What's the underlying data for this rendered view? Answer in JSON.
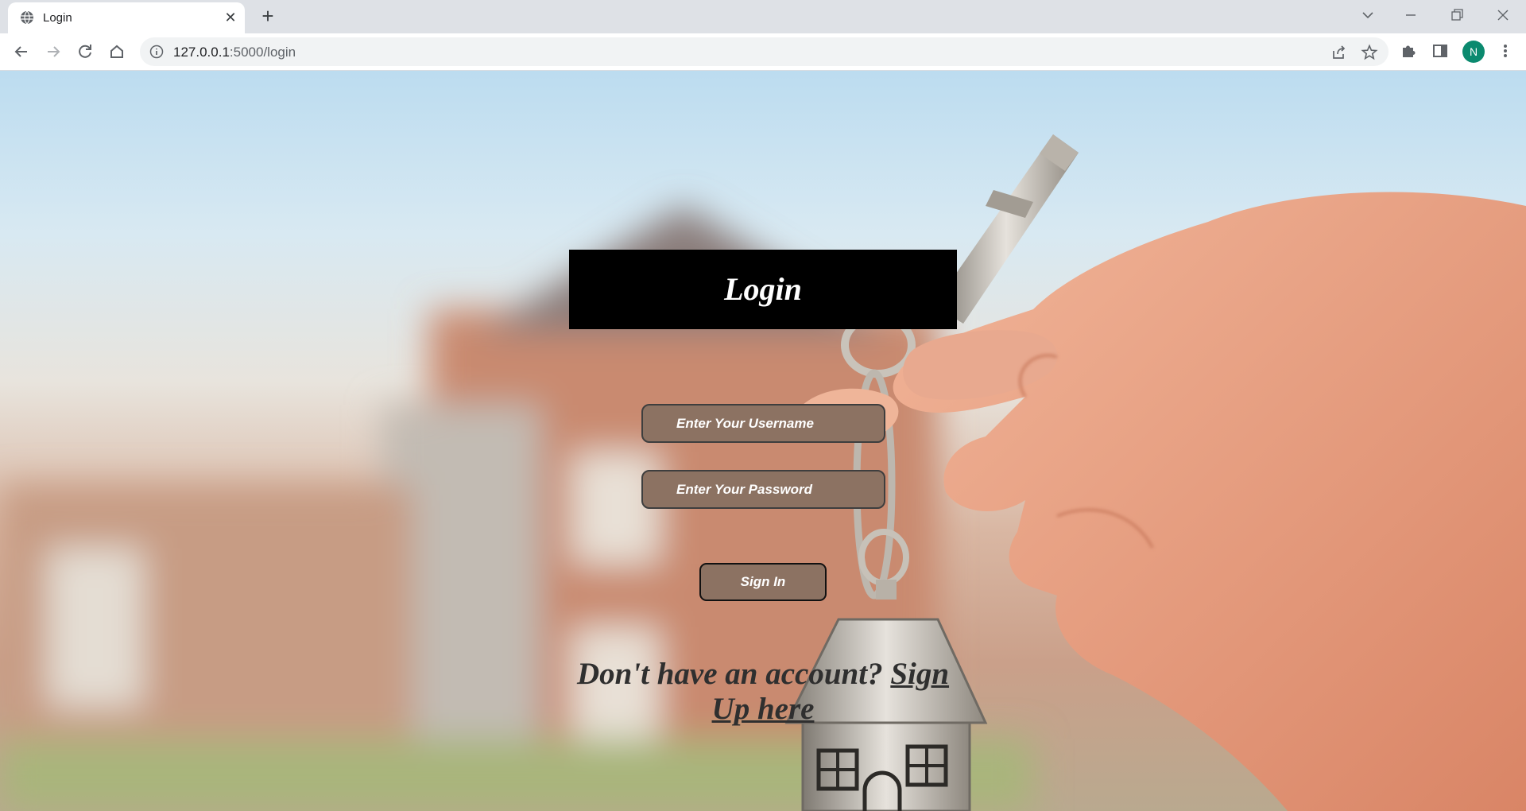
{
  "browser": {
    "tab_title": "Login",
    "url_host": "127.0.0.1",
    "url_rest": ":5000/login",
    "avatar_letter": "N"
  },
  "page": {
    "heading": "Login",
    "username_placeholder": "Enter Your Username",
    "password_placeholder": "Enter Your Password",
    "signin_label": "Sign In",
    "signup_prompt": "Don't have an account?",
    "signup_link": "Sign Up here"
  },
  "colors": {
    "header_bg": "#000000",
    "field_bg": "#8c7262",
    "text_dark": "#2f2f2f"
  },
  "icons": [
    "globe-icon",
    "close-icon",
    "plus-icon",
    "back-icon",
    "forward-icon",
    "reload-icon",
    "home-icon",
    "info-icon",
    "share-icon",
    "star-icon",
    "puzzle-icon",
    "sidepanel-icon",
    "kebab-menu-icon"
  ]
}
